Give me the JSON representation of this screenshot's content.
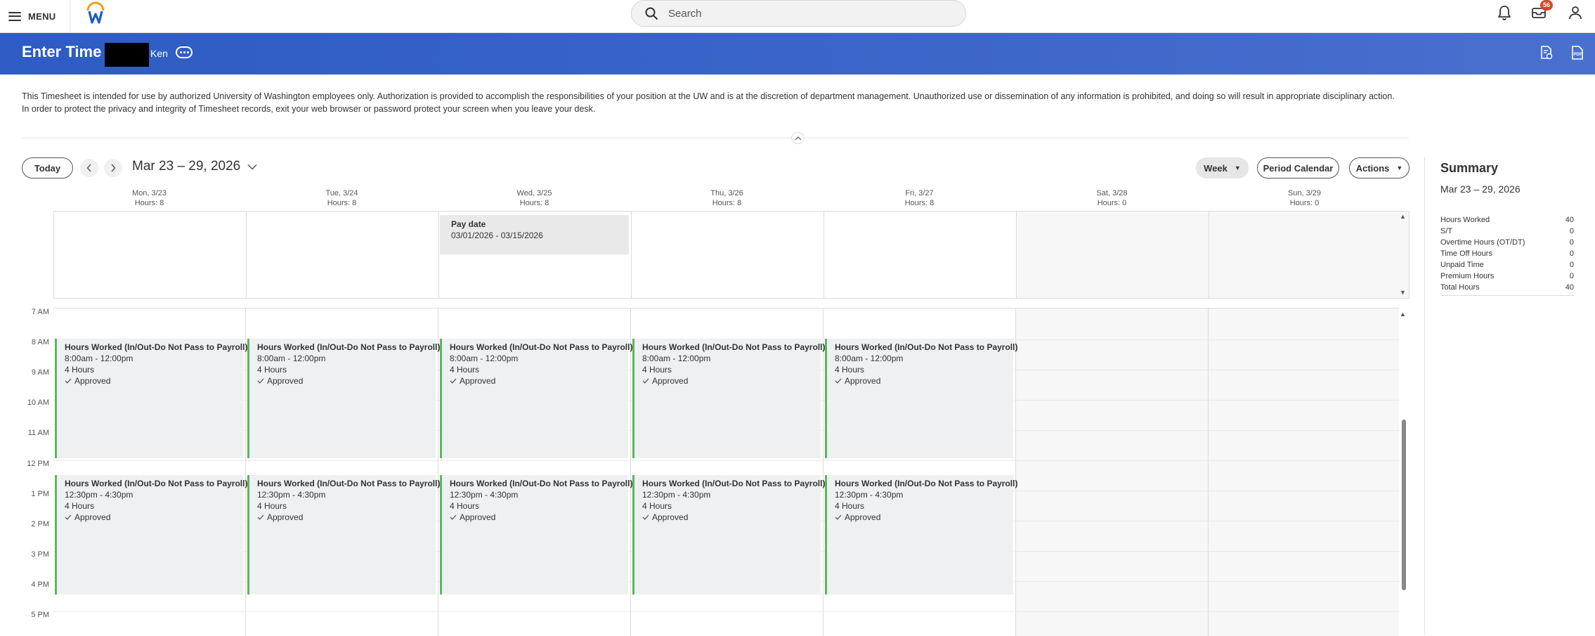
{
  "nav": {
    "menu_label": "MENU",
    "search_placeholder": "Search",
    "inbox_badge": "56"
  },
  "header": {
    "title": "Enter Time",
    "name": "Ken"
  },
  "notice": {
    "line1": "This Timesheet is intended for use by authorized University of Washington employees only. Authorization is provided to accomplish the responsibilities of your position at the UW and is at the discretion of department management. Unauthorized use or dissemination of any information is prohibited, and doing so will result in appropriate disciplinary action.",
    "line2": "In order to protect the privacy and integrity of Timesheet records, exit your web browser or password protect your screen when you leave your desk."
  },
  "toolbar": {
    "today_label": "Today",
    "date_range": "Mar 23 – 29, 2026",
    "view_label": "Week",
    "period_calendar_label": "Period Calendar",
    "actions_label": "Actions"
  },
  "days": [
    {
      "label": "Mon, 3/23",
      "hours": "Hours: 8"
    },
    {
      "label": "Tue, 3/24",
      "hours": "Hours: 8"
    },
    {
      "label": "Wed, 3/25",
      "hours": "Hours: 8"
    },
    {
      "label": "Thu, 3/26",
      "hours": "Hours: 8"
    },
    {
      "label": "Fri, 3/27",
      "hours": "Hours: 8"
    },
    {
      "label": "Sat, 3/28",
      "hours": "Hours: 0"
    },
    {
      "label": "Sun, 3/29",
      "hours": "Hours: 0"
    }
  ],
  "pay_date": {
    "title": "Pay date",
    "range": "03/01/2026 - 03/15/2026"
  },
  "time_labels": [
    "7 AM",
    "8 AM",
    "9 AM",
    "10 AM",
    "11 AM",
    "12 PM",
    "1 PM",
    "2 PM",
    "3 PM",
    "4 PM",
    "5 PM"
  ],
  "events": {
    "morning": {
      "title": "Hours Worked (In/Out-Do Not Pass to Payroll)",
      "time": "8:00am - 12:00pm",
      "hours": "4 Hours",
      "status": "Approved"
    },
    "afternoon": {
      "title": "Hours Worked (In/Out-Do Not Pass to Payroll)",
      "time": "12:30pm - 4:30pm",
      "hours": "4 Hours",
      "status": "Approved"
    }
  },
  "summary": {
    "title": "Summary",
    "range": "Mar 23 – 29, 2026",
    "rows": [
      {
        "label": "Hours Worked",
        "value": "40"
      },
      {
        "label": "S/T",
        "value": "0"
      },
      {
        "label": "Overtime Hours (OT/DT)",
        "value": "0"
      },
      {
        "label": "Time Off Hours",
        "value": "0"
      },
      {
        "label": "Unpaid Time",
        "value": "0"
      },
      {
        "label": "Premium Hours",
        "value": "0"
      },
      {
        "label": "Total Hours",
        "value": "40"
      }
    ]
  },
  "colors": {
    "header_blue": "#3d66c9",
    "approved_green": "#5cb85c",
    "badge_red": "#d9452b"
  }
}
